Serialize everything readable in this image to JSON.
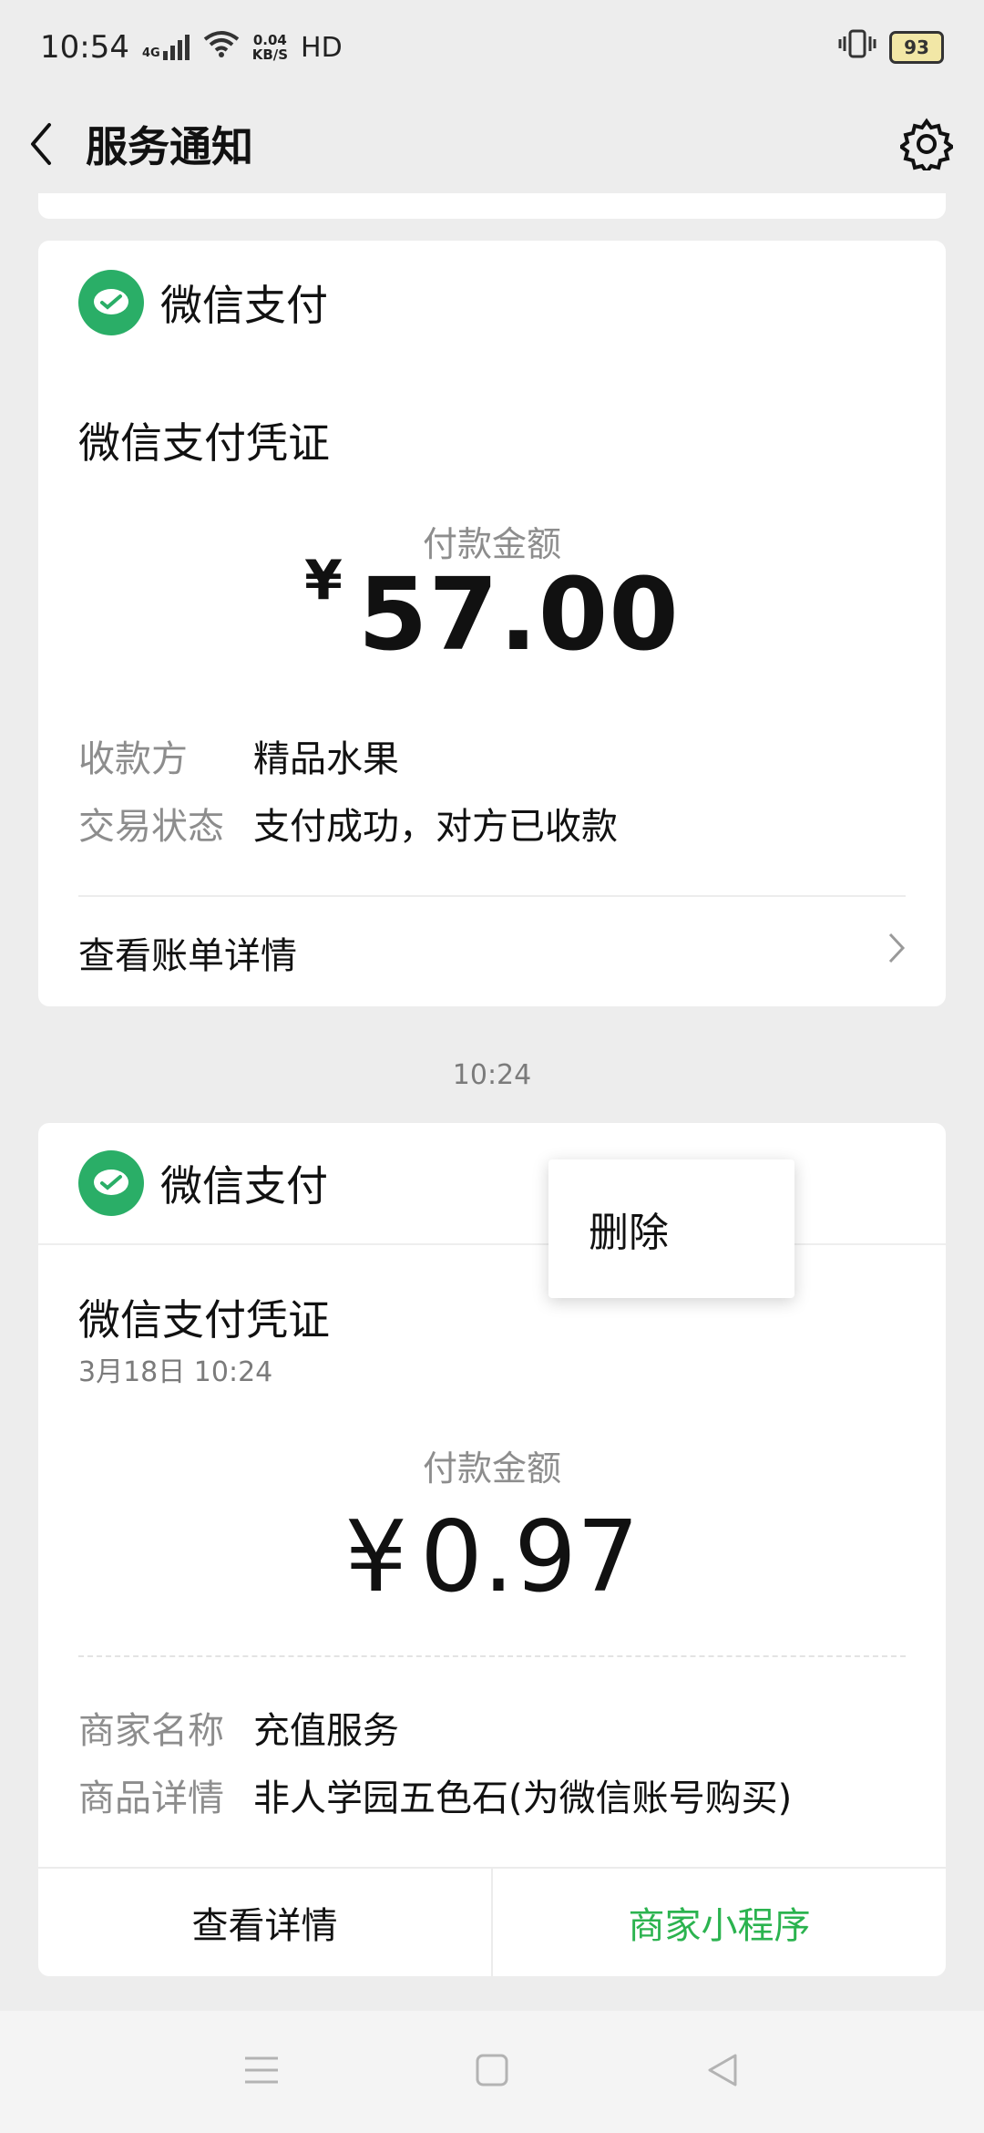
{
  "status_bar": {
    "time": "10:54",
    "network": "4G",
    "speed_value": "0.04",
    "speed_unit": "KB/S",
    "hd": "HD",
    "battery": "93"
  },
  "header": {
    "title": "服务通知"
  },
  "card1": {
    "brand": "微信支付",
    "voucher_title": "微信支付凭证",
    "amount_label": "付款金额",
    "currency": "¥",
    "amount": "57.00",
    "rows": [
      {
        "key": "收款方",
        "value": "精品水果"
      },
      {
        "key": "交易状态",
        "value": "支付成功，对方已收款"
      }
    ],
    "detail_link": "查看账单详情"
  },
  "timestamp": "10:24",
  "card2": {
    "brand": "微信支付",
    "voucher_title": "微信支付凭证",
    "date": "3月18日  10:24",
    "amount_label": "付款金额",
    "currency": "¥",
    "amount": "0.97",
    "rows": [
      {
        "key": "商家名称",
        "value": "充值服务"
      },
      {
        "key": "商品详情",
        "value": "非人学园五色石(为微信账号购买)"
      }
    ],
    "button_left": "查看详情",
    "button_right": "商家小程序"
  },
  "popup_menu": {
    "delete": "删除"
  },
  "colors": {
    "wechat_green": "#2aae67",
    "link_green": "#2bb34f",
    "background": "#ededed"
  }
}
